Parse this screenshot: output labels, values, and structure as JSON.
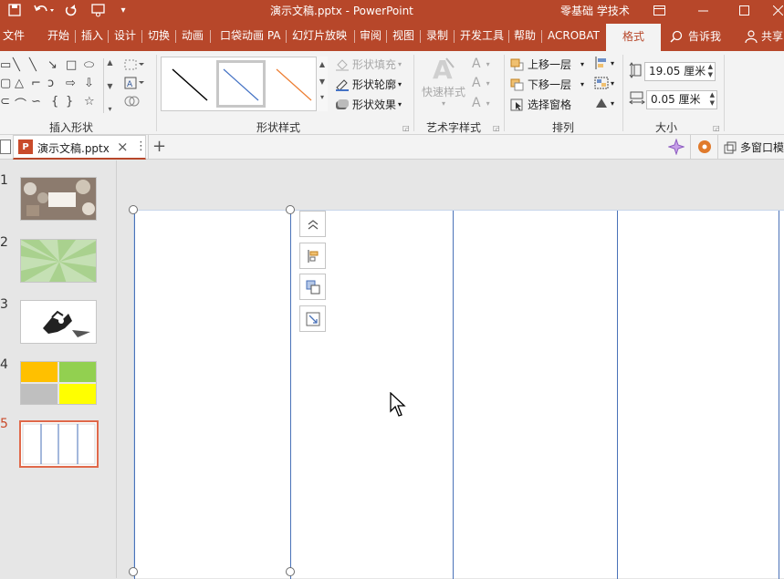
{
  "titlebar": {
    "save_icon": "save-icon",
    "undo_icon": "undo-icon",
    "redo_icon": "repeat-icon",
    "present_icon": "present-from-start-icon",
    "customize_icon": "customize-qat-icon",
    "document_title": "演示文稿.pptx  -  PowerPoint",
    "user_name": "零基础 学技术",
    "ribbon_display_icon": "ribbon-display-options-icon",
    "minimize_icon": "minimize-icon",
    "maximize_icon": "maximize-icon",
    "close_icon": "close-icon"
  },
  "tabs": [
    {
      "label": "文件"
    },
    {
      "label": "开始"
    },
    {
      "label": "插入"
    },
    {
      "label": "设计"
    },
    {
      "label": "切换"
    },
    {
      "label": "动画"
    },
    {
      "label": "口袋动画 PA"
    },
    {
      "label": "幻灯片放映"
    },
    {
      "label": "审阅"
    },
    {
      "label": "视图"
    },
    {
      "label": "录制"
    },
    {
      "label": "开发工具"
    },
    {
      "label": "帮助"
    },
    {
      "label": "ACROBAT"
    },
    {
      "label": "格式"
    }
  ],
  "tellme": {
    "label": "告诉我",
    "icon": "lightbulb-search-icon"
  },
  "share": {
    "label": "共享",
    "icon": "person-icon"
  },
  "ribbon": {
    "insert_shapes": {
      "label": "插入形状"
    },
    "shape_styles": {
      "label": "形状样式",
      "fill": "形状填充",
      "outline": "形状轮廓",
      "effects": "形状效果",
      "swatches": [
        "#000000",
        "#4472c4",
        "#ed7d31"
      ]
    },
    "wordart": {
      "label": "艺术字样式",
      "quick_styles": "快速样式"
    },
    "arrange": {
      "label": "排列",
      "bring_forward": "上移一层",
      "send_backward": "下移一层",
      "selection_pane": "选择窗格"
    },
    "size": {
      "label": "大小",
      "height": "19.05 厘米",
      "width": "0.05 厘米"
    }
  },
  "doc_tab": {
    "filename": "演示文稿.pptx",
    "close": "×",
    "more": "⋮",
    "new": "+"
  },
  "doc_bar_right": {
    "multiwindow": "多窗口模"
  },
  "thumbnails": [
    {
      "number": "1"
    },
    {
      "number": "2"
    },
    {
      "number": "3"
    },
    {
      "number": "4"
    },
    {
      "number": "5"
    }
  ],
  "colors": {
    "accent": "#b7472a",
    "line_blue": "#4a72b8",
    "thumb4": [
      "#ffc000",
      "#92d050",
      "#bfbfbf",
      "#ffff00"
    ]
  }
}
